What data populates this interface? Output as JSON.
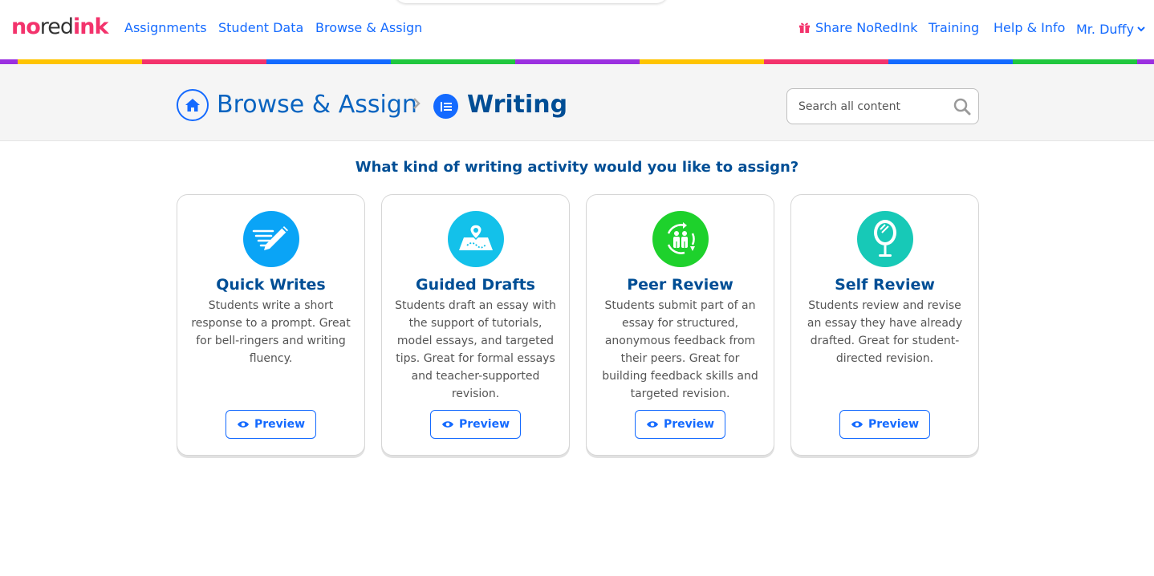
{
  "brand": {
    "logo_part1": "no",
    "logo_part2": "red",
    "logo_part3": "ink"
  },
  "nav": {
    "left": [
      "Assignments",
      "Student Data",
      "Browse & Assign"
    ],
    "share": "Share NoRedInk",
    "training": "Training",
    "help": "Help & Info",
    "user": "Mr. Duffy"
  },
  "rainbow_colors": [
    "#9b30e0",
    "#ffc400",
    "#f3336c",
    "#146aff",
    "#20c73e",
    "#9b30e0",
    "#ffc400",
    "#f3336c",
    "#146aff",
    "#20c73e",
    "#9b30e0"
  ],
  "breadcrumb": {
    "parent": "Browse & Assign",
    "current": "Writing"
  },
  "search": {
    "placeholder": "Search all content"
  },
  "question": "What kind of writing activity would you like to assign?",
  "cards": [
    {
      "title": "Quick Writes",
      "icon": "pencil-lines-icon",
      "color": "#0aa4f6",
      "description": "Students write a short response to a prompt. Great for bell-ringers and writing fluency.",
      "button": "Preview"
    },
    {
      "title": "Guided Drafts",
      "icon": "map-pin-icon",
      "color": "#13c1ea",
      "description": "Students draft an essay with the support of tutorials, model essays, and targeted tips. Great for formal essays and teacher-supported revision.",
      "button": "Preview"
    },
    {
      "title": "Peer Review",
      "icon": "peers-cycle-icon",
      "color": "#1ed12c",
      "description": "Students submit part of an essay for structured, anonymous feedback from their peers. Great for building feedback skills and targeted revision.",
      "button": "Preview"
    },
    {
      "title": "Self Review",
      "icon": "mirror-icon",
      "color": "#17c9b7",
      "description": "Students review and revise an essay they have already drafted. Great for student-directed revision.",
      "button": "Preview"
    }
  ]
}
